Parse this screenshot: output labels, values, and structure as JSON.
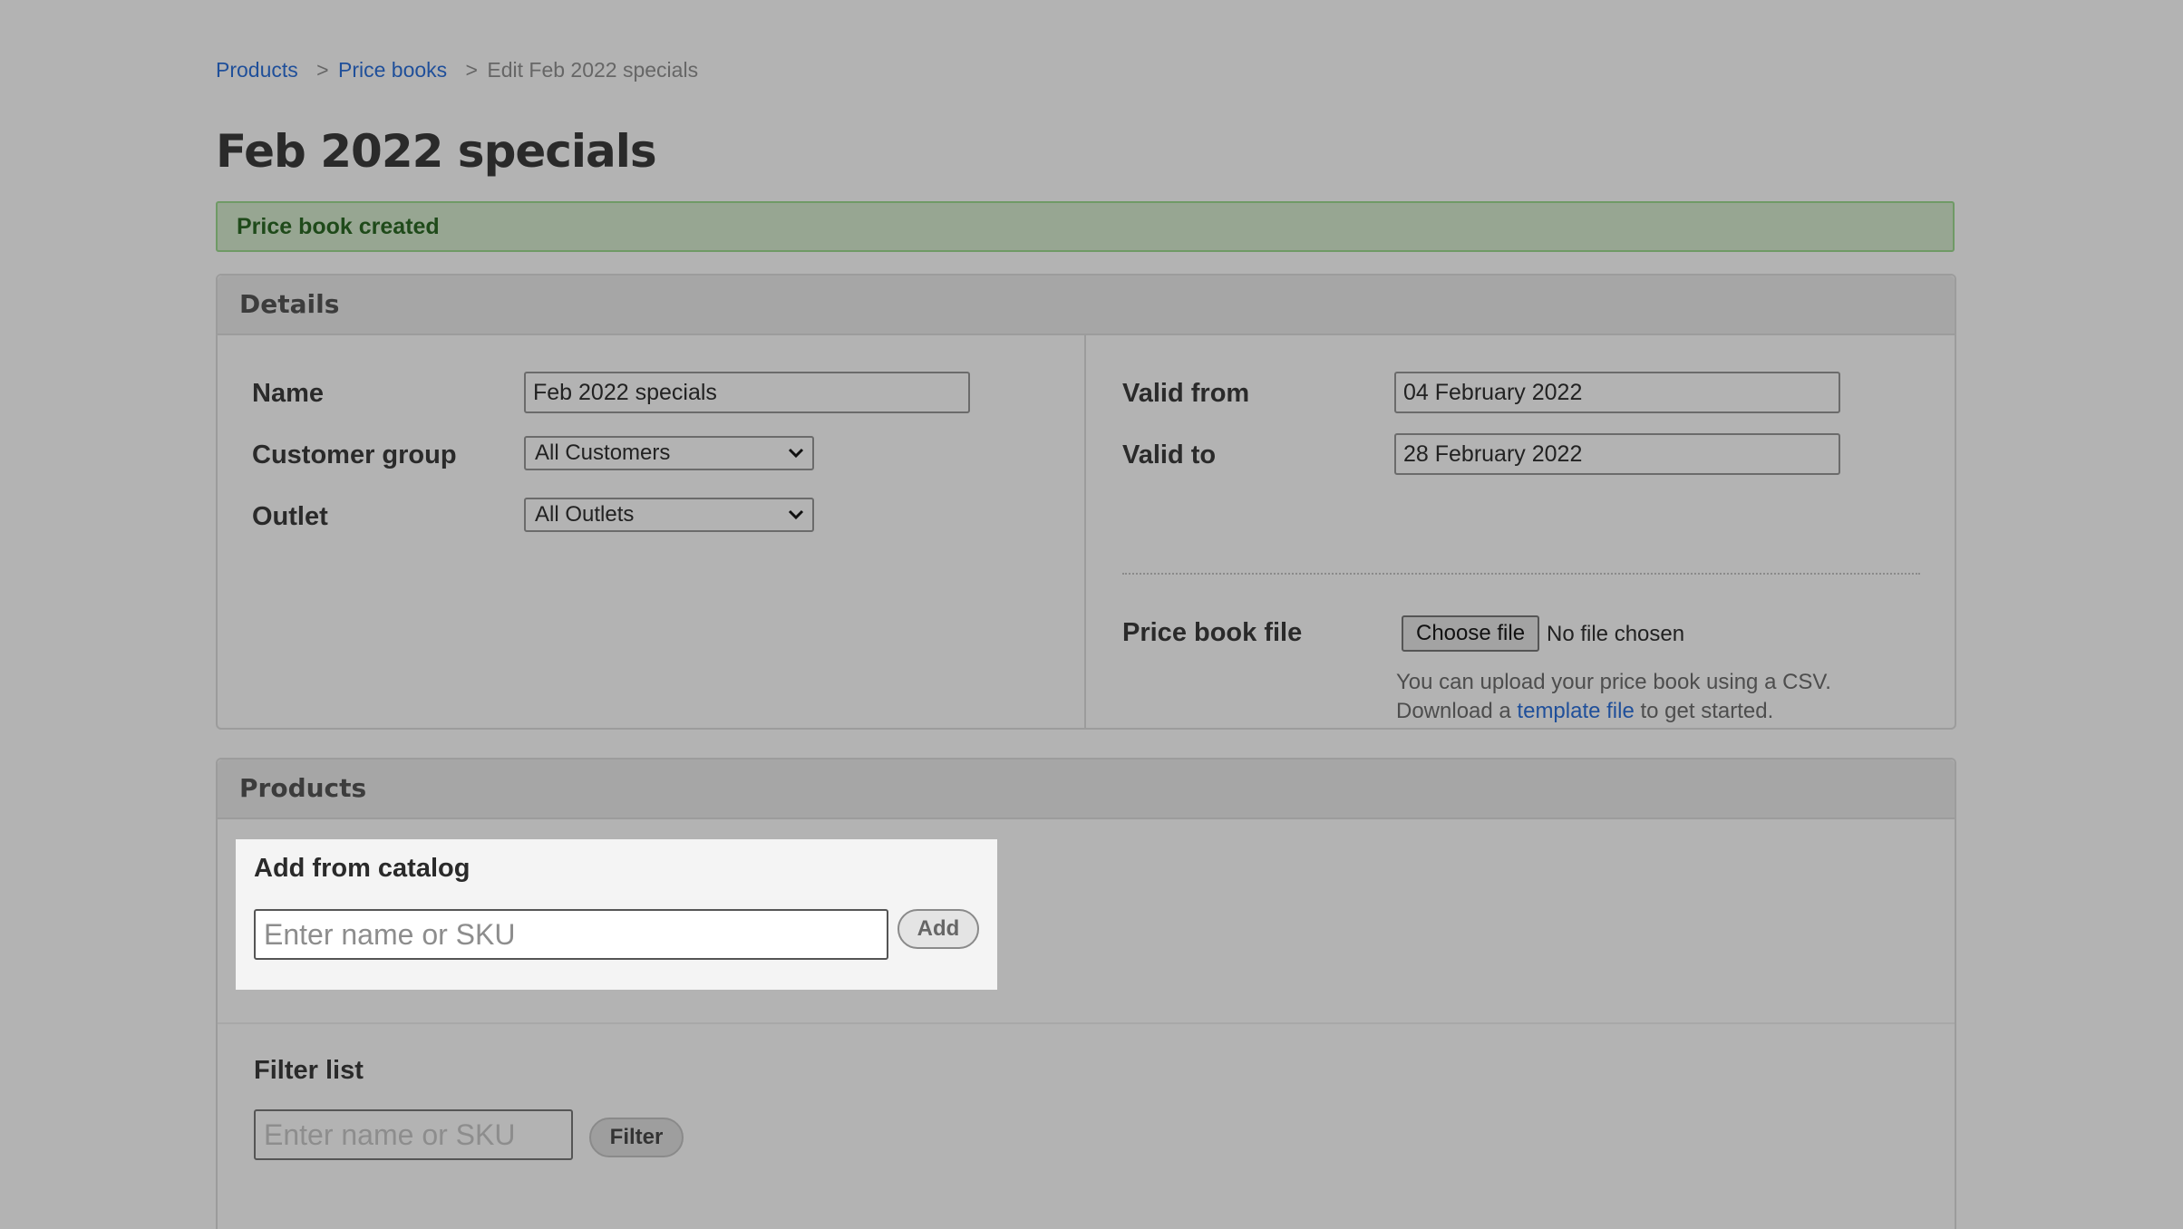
{
  "breadcrumb": {
    "products": "Products",
    "sep1": ">",
    "price_books": "Price books",
    "sep2": ">",
    "current": "Edit Feb 2022 specials"
  },
  "title": "Feb 2022 specials",
  "alert": "Price book created",
  "details": {
    "heading": "Details",
    "name_label": "Name",
    "name_value": "Feb 2022 specials",
    "customer_group_label": "Customer group",
    "customer_group_value": "All Customers",
    "outlet_label": "Outlet",
    "outlet_value": "All Outlets",
    "valid_from_label": "Valid from",
    "valid_from_value": "04 February 2022",
    "valid_to_label": "Valid to",
    "valid_to_value": "28 February 2022",
    "price_book_file_label": "Price book file",
    "choose_file_label": "Choose file",
    "file_status": "No file chosen",
    "help_line1": "You can upload your price book using a CSV.",
    "help_line2_prefix": "Download a",
    "help_link": "template file",
    "help_line2_suffix": "to get started."
  },
  "products": {
    "heading": "Products",
    "add_from_catalog": "Add from catalog",
    "catalog_placeholder": "Enter name or SKU",
    "add_button": "Add",
    "filter_heading": "Filter list",
    "filter_placeholder": "Enter name or SKU",
    "filter_button": "Filter"
  }
}
